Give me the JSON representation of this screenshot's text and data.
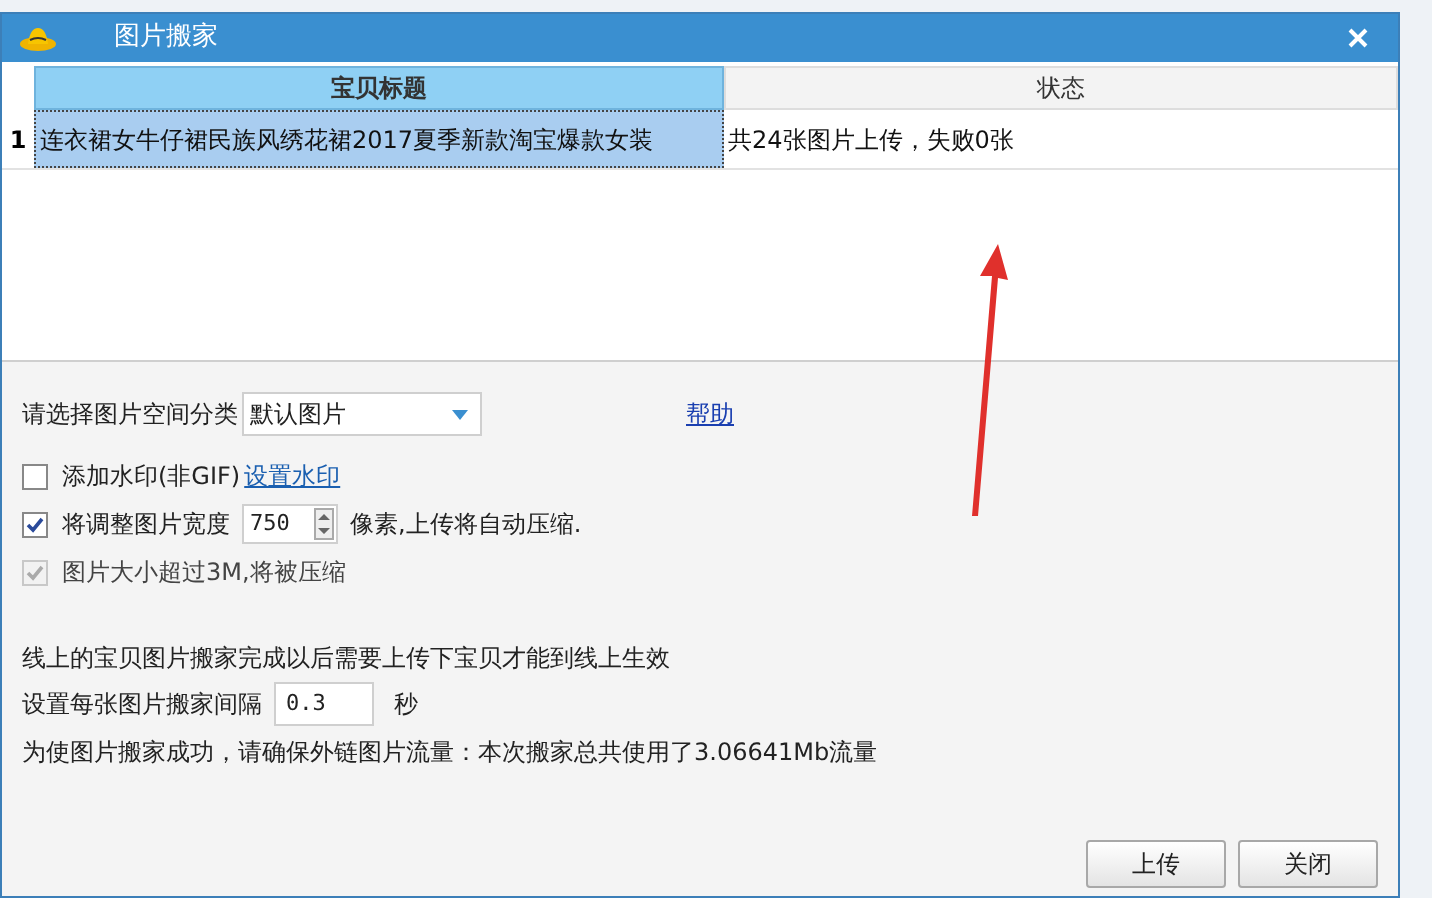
{
  "window": {
    "title": "图片搬家"
  },
  "table": {
    "columns": [
      "宝贝标题",
      "状态"
    ],
    "rows": [
      {
        "index": "1",
        "cells": [
          "连衣裙女牛仔裙民族风绣花裙2017夏季新款淘宝爆款女装",
          "共24张图片上传，失败0张"
        ],
        "selected": true
      }
    ]
  },
  "category": {
    "label": "请选择图片空间分类",
    "value": "默认图片"
  },
  "help_link": "帮助",
  "options": [
    {
      "kind": "watermark",
      "label": "添加水印(非GIF)",
      "link": "设置水印",
      "checked": false,
      "disabled": false
    },
    {
      "kind": "width",
      "label": "将调整图片宽度",
      "value": "750",
      "suffix": "像素,上传将自动压缩.",
      "checked": true,
      "disabled": false
    },
    {
      "kind": "plain",
      "label": "图片大小超过3M,将被压缩",
      "checked": true,
      "disabled": true
    }
  ],
  "notice": "线上的宝贝图片搬家完成以后需要上传下宝贝才能到线上生效",
  "interval": {
    "label": "设置每张图片搬家间隔",
    "value": "0.3",
    "unit": "秒"
  },
  "usage": "为使图片搬家成功，请确保外链图片流量：本次搬家总共使用了3.06641Mb流量",
  "buttons": [
    "上传",
    "关闭"
  ]
}
